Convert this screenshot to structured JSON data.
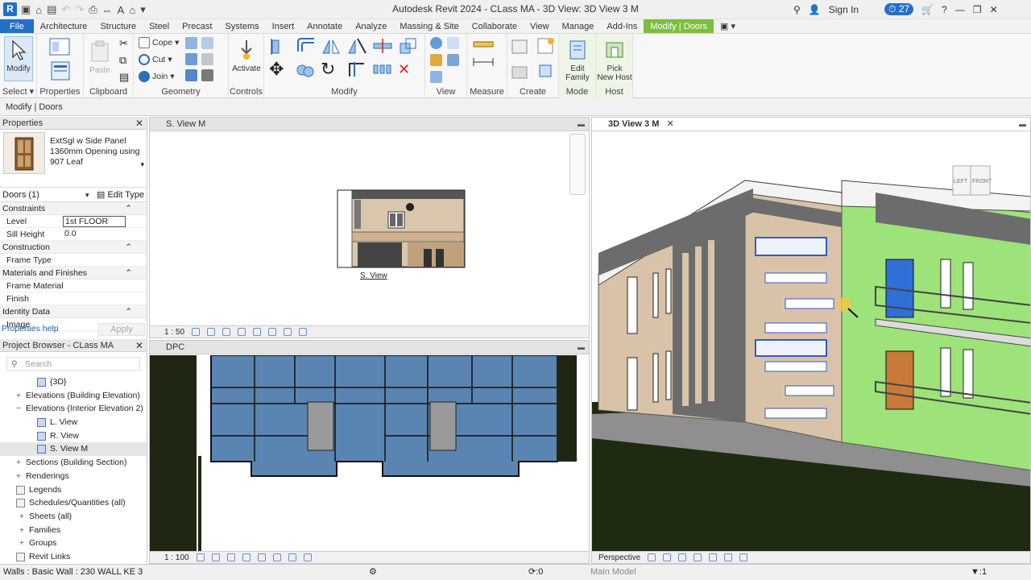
{
  "app": {
    "title": "Autodesk Revit 2024 - CLass MA - 3D View: 3D View 3 M",
    "logo_letter": "R",
    "sign_in": "Sign In",
    "notification_count": "27"
  },
  "tabs": [
    "File",
    "Architecture",
    "Structure",
    "Steel",
    "Precast",
    "Systems",
    "Insert",
    "Annotate",
    "Analyze",
    "Massing & Site",
    "Collaborate",
    "View",
    "Manage",
    "Add-Ins",
    "Modify | Doors"
  ],
  "ribbon": {
    "select_label": "Select",
    "modify_label": "Modify",
    "panels": {
      "properties": "Properties",
      "clipboard": "Clipboard",
      "geometry": "Geometry",
      "controls": "Controls",
      "modify": "Modify",
      "view": "View",
      "measure": "Measure",
      "create": "Create",
      "mode": "Mode",
      "host": "Host"
    },
    "cope": "Cope",
    "cut": "Cut",
    "join": "Join",
    "paste": "Paste",
    "activate": "Activate",
    "edit_family_1": "Edit",
    "edit_family_2": "Family",
    "pick_host_1": "Pick",
    "pick_host_2": "New Host"
  },
  "context_label": "Modify | Doors",
  "properties": {
    "title": "Properties",
    "type_name_1": "ExtSgl w Side Panel",
    "type_name_2": "1360mm Opening using",
    "type_name_3": "907 Leaf",
    "instance_filter": "Doors (1)",
    "edit_type": "Edit Type",
    "groups": [
      {
        "name": "Constraints",
        "rows": [
          {
            "k": "Level",
            "v": "1st FLOOR",
            "box": true
          },
          {
            "k": "Sill Height",
            "v": "0.0"
          }
        ]
      },
      {
        "name": "Construction",
        "rows": [
          {
            "k": "Frame Type",
            "v": ""
          }
        ]
      },
      {
        "name": "Materials and Finishes",
        "rows": [
          {
            "k": "Frame Material",
            "v": ""
          },
          {
            "k": "Finish",
            "v": ""
          }
        ]
      },
      {
        "name": "Identity Data",
        "rows": [
          {
            "k": "Image",
            "v": ""
          }
        ]
      }
    ],
    "help_link": "Properties help",
    "apply": "Apply"
  },
  "browser": {
    "title": "Project Browser - CLass MA",
    "search_placeholder": "Search",
    "items": [
      {
        "label": "{3D}",
        "indent": 62,
        "ex": "",
        "icon": "view"
      },
      {
        "label": "Elevations (Building Elevation)",
        "indent": 32,
        "ex": "+"
      },
      {
        "label": "Elevations (Interior Elevation 2)",
        "indent": 32,
        "ex": "−"
      },
      {
        "label": "L. View",
        "indent": 62,
        "ex": "",
        "icon": "view"
      },
      {
        "label": "R. View",
        "indent": 62,
        "ex": "",
        "icon": "view"
      },
      {
        "label": "S. View M",
        "indent": 62,
        "ex": "",
        "icon": "view",
        "sel": true
      },
      {
        "label": "Sections (Building Section)",
        "indent": 32,
        "ex": "+"
      },
      {
        "label": "Renderings",
        "indent": 32,
        "ex": "+"
      },
      {
        "label": "Legends",
        "indent": 36,
        "ex": "",
        "icon": "legend"
      },
      {
        "label": "Schedules/Quantities (all)",
        "indent": 36,
        "ex": "",
        "icon": "schedule"
      },
      {
        "label": "Sheets (all)",
        "indent": 36,
        "ex": "+"
      },
      {
        "label": "Families",
        "indent": 36,
        "ex": "+"
      },
      {
        "label": "Groups",
        "indent": 36,
        "ex": "+"
      },
      {
        "label": "Revit Links",
        "indent": 36,
        "ex": "",
        "icon": "link"
      }
    ]
  },
  "views": {
    "sview": {
      "title": "S. View M",
      "scale": "1 : 50",
      "caption": "S. View"
    },
    "dpc": {
      "title": "DPC",
      "scale": "1 : 100"
    },
    "v3d": {
      "title": "3D View 3 M",
      "footer": "Perspective",
      "cube_left": "LEFT",
      "cube_front": "FRONT"
    }
  },
  "status": {
    "text": "Walls : Basic Wall : 230 WALL KE 3",
    "zero": ":0",
    "model": "Main Model",
    "filter": ":1"
  },
  "colors": {
    "file_tab": "#2470c7",
    "context_tab": "#7cbf3f",
    "plan_fill": "#5a85b3",
    "wall_green": "#9de37a",
    "wall_beige": "#d9c3a8"
  }
}
